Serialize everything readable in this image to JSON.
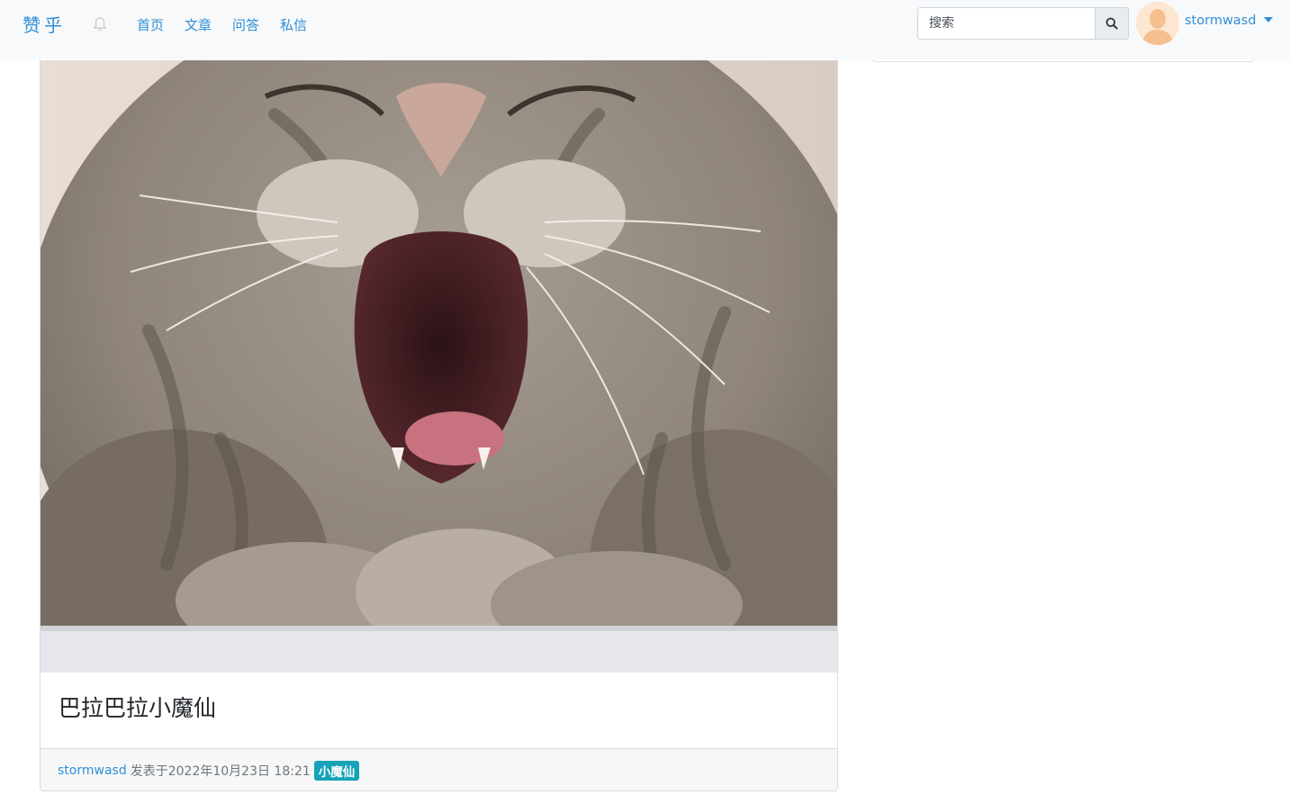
{
  "navbar": {
    "brand": "赞乎",
    "links": [
      "首页",
      "文章",
      "问答",
      "私信"
    ],
    "search_placeholder": "搜索",
    "username": "stormwasd"
  },
  "post": {
    "image_alt": "yawning tabby cat",
    "title": "巴拉巴拉小魔仙",
    "author": "stormwasd",
    "published": "发表于2022年10月23日 18:21",
    "tag": "小魔仙"
  },
  "colors": {
    "accent": "#2f8fd8",
    "tag_bg": "#17a2b8",
    "navbar_bg": "#f8f9fa"
  }
}
